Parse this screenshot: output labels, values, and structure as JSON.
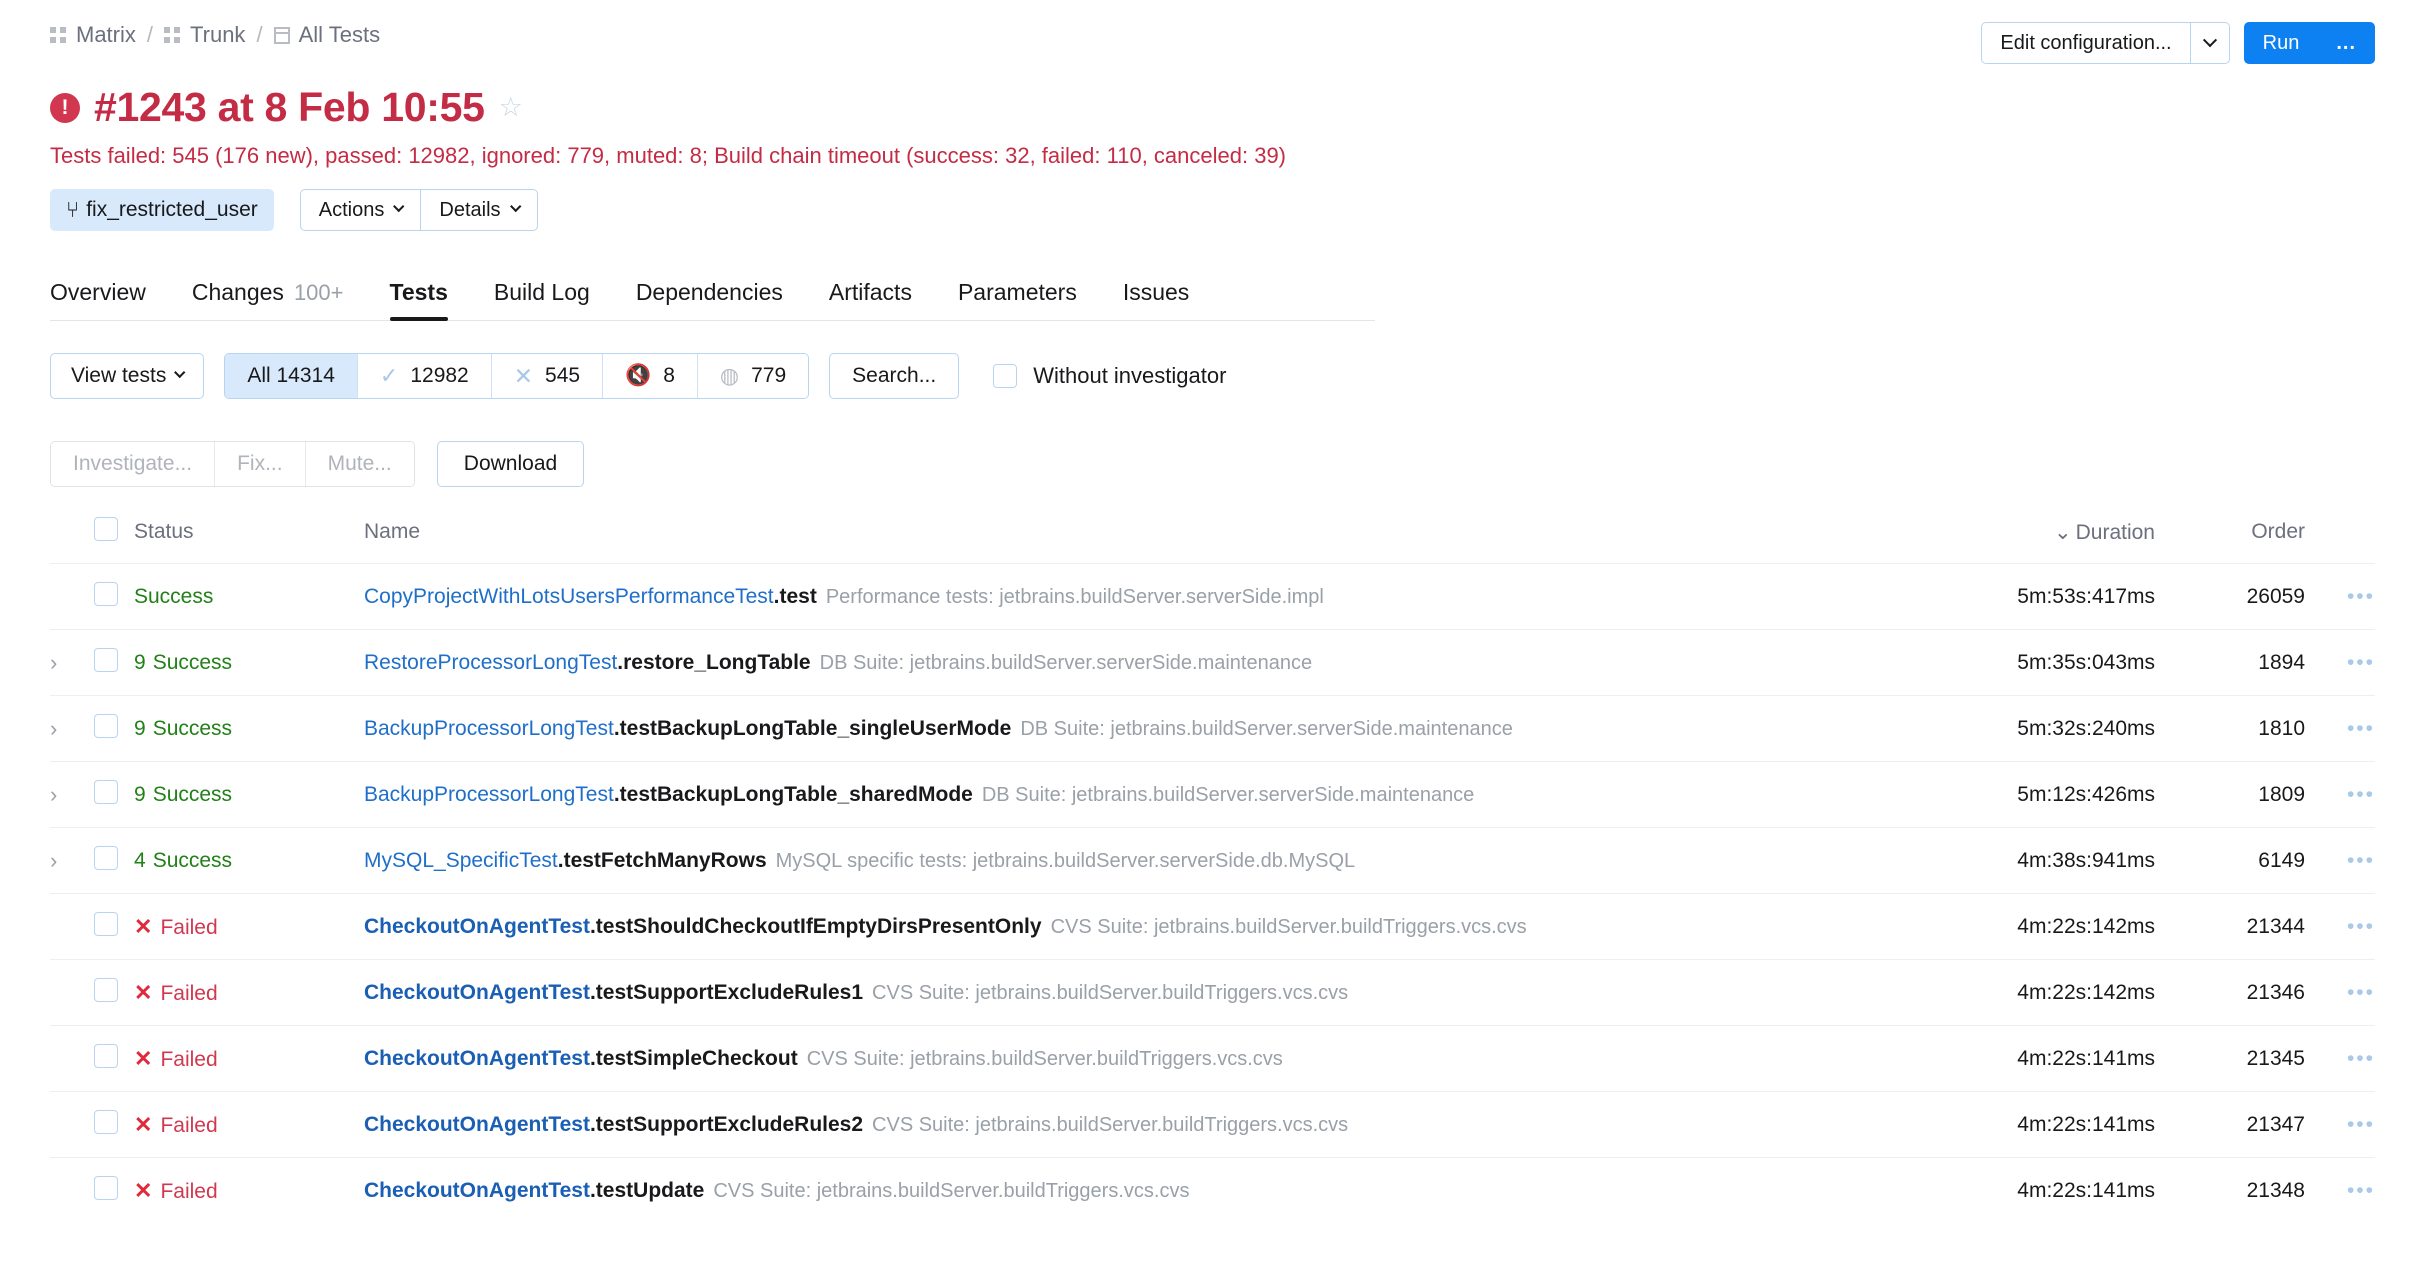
{
  "breadcrumb": {
    "items": [
      {
        "label": "Matrix",
        "icon": "grid-icon"
      },
      {
        "label": "Trunk",
        "icon": "grid-icon"
      },
      {
        "label": "All Tests",
        "icon": "configuration-icon"
      }
    ],
    "separator": "/"
  },
  "top_actions": {
    "edit_configuration": "Edit configuration...",
    "edit_configuration_caret": "chevron-down-icon",
    "run": "Run",
    "more": "..."
  },
  "header": {
    "error_icon": "!",
    "title": "#1243 at 8 Feb 10:55",
    "star": "☆",
    "status_line": "Tests failed: 545 (176 new), passed: 12982, ignored: 779, muted: 8; Build chain timeout (success: 32, failed: 110, canceled: 39)",
    "title_color": "#c42b44"
  },
  "sub_actions": {
    "branch": "fix_restricted_user",
    "branch_icon": "branch-icon",
    "actions": "Actions",
    "details": "Details"
  },
  "tabs": [
    {
      "label": "Overview",
      "count": "",
      "active": false
    },
    {
      "label": "Changes",
      "count": "100+",
      "active": false
    },
    {
      "label": "Tests",
      "count": "",
      "active": true
    },
    {
      "label": "Build Log",
      "count": "",
      "active": false
    },
    {
      "label": "Dependencies",
      "count": "",
      "active": false
    },
    {
      "label": "Artifacts",
      "count": "",
      "active": false
    },
    {
      "label": "Parameters",
      "count": "",
      "active": false
    },
    {
      "label": "Issues",
      "count": "",
      "active": false
    }
  ],
  "filters": {
    "view_tests": "View tests",
    "segments": [
      {
        "name": "all",
        "icon": "",
        "label": "All 14314",
        "selected": true
      },
      {
        "name": "passed",
        "icon": "✓",
        "label": "12982",
        "selected": false
      },
      {
        "name": "failed",
        "icon": "✕",
        "label": "545",
        "selected": false
      },
      {
        "name": "muted",
        "icon": "muted-icon",
        "label": "8",
        "selected": false
      },
      {
        "name": "ignored",
        "icon": "ignored-icon",
        "label": "779",
        "selected": false
      }
    ],
    "search": "Search...",
    "without_investigator": "Without investigator",
    "without_investigator_checked": false
  },
  "bulk_actions": {
    "investigate": "Investigate...",
    "fix": "Fix...",
    "mute": "Mute...",
    "download": "Download"
  },
  "table": {
    "columns": {
      "status": "Status",
      "name": "Name",
      "duration": "Duration",
      "order": "Order",
      "duration_sort_icon": "chevron-down-icon"
    },
    "rows": [
      {
        "expandable": false,
        "status_count": "",
        "status": "Success",
        "state": "success",
        "class_name": "CopyProjectWithLotsUsersPerformanceTest",
        "method": ".test",
        "suite": "Performance tests: jetbrains.buildServer.serverSide.impl",
        "duration": "5m:53s:417ms",
        "order": "26059",
        "menu": "•••"
      },
      {
        "expandable": true,
        "status_count": "9",
        "status": "Success",
        "state": "success",
        "class_name": "RestoreProcessorLongTest",
        "method": ".restore_LongTable",
        "suite": "DB Suite: jetbrains.buildServer.serverSide.maintenance",
        "duration": "5m:35s:043ms",
        "order": "1894",
        "menu": "•••"
      },
      {
        "expandable": true,
        "status_count": "9",
        "status": "Success",
        "state": "success",
        "class_name": "BackupProcessorLongTest",
        "method": ".testBackupLongTable_singleUserMode",
        "suite": "DB Suite: jetbrains.buildServer.serverSide.maintenance",
        "duration": "5m:32s:240ms",
        "order": "1810",
        "menu": "•••"
      },
      {
        "expandable": true,
        "status_count": "9",
        "status": "Success",
        "state": "success",
        "class_name": "BackupProcessorLongTest",
        "method": ".testBackupLongTable_sharedMode",
        "suite": "DB Suite: jetbrains.buildServer.serverSide.maintenance",
        "duration": "5m:12s:426ms",
        "order": "1809",
        "menu": "•••"
      },
      {
        "expandable": true,
        "status_count": "4",
        "status": "Success",
        "state": "success",
        "class_name": "MySQL_SpecificTest",
        "method": ".testFetchManyRows",
        "suite": "MySQL specific tests: jetbrains.buildServer.serverSide.db.MySQL",
        "duration": "4m:38s:941ms",
        "order": "6149",
        "menu": "•••"
      },
      {
        "expandable": false,
        "status_count": "",
        "status": "Failed",
        "state": "failed",
        "class_name": "CheckoutOnAgentTest",
        "method": ".testShouldCheckoutIfEmptyDirsPresentOnly",
        "suite": "CVS Suite: jetbrains.buildServer.buildTriggers.vcs.cvs",
        "duration": "4m:22s:142ms",
        "order": "21344",
        "menu": "•••"
      },
      {
        "expandable": false,
        "status_count": "",
        "status": "Failed",
        "state": "failed",
        "class_name": "CheckoutOnAgentTest",
        "method": ".testSupportExcludeRules1",
        "suite": "CVS Suite: jetbrains.buildServer.buildTriggers.vcs.cvs",
        "duration": "4m:22s:142ms",
        "order": "21346",
        "menu": "•••"
      },
      {
        "expandable": false,
        "status_count": "",
        "status": "Failed",
        "state": "failed",
        "class_name": "CheckoutOnAgentTest",
        "method": ".testSimpleCheckout",
        "suite": "CVS Suite: jetbrains.buildServer.buildTriggers.vcs.cvs",
        "duration": "4m:22s:141ms",
        "order": "21345",
        "menu": "•••"
      },
      {
        "expandable": false,
        "status_count": "",
        "status": "Failed",
        "state": "failed",
        "class_name": "CheckoutOnAgentTest",
        "method": ".testSupportExcludeRules2",
        "suite": "CVS Suite: jetbrains.buildServer.buildTriggers.vcs.cvs",
        "duration": "4m:22s:141ms",
        "order": "21347",
        "menu": "•••"
      },
      {
        "expandable": false,
        "status_count": "",
        "status": "Failed",
        "state": "failed",
        "class_name": "CheckoutOnAgentTest",
        "method": ".testUpdate",
        "suite": "CVS Suite: jetbrains.buildServer.buildTriggers.vcs.cvs",
        "duration": "4m:22s:141ms",
        "order": "21348",
        "menu": "•••"
      }
    ]
  },
  "colors": {
    "accent_blue": "#0d80f2",
    "error_red": "#c42b44",
    "success_green": "#218117",
    "link_blue": "#1f6fca",
    "muted_gray": "#9aa0a8"
  }
}
